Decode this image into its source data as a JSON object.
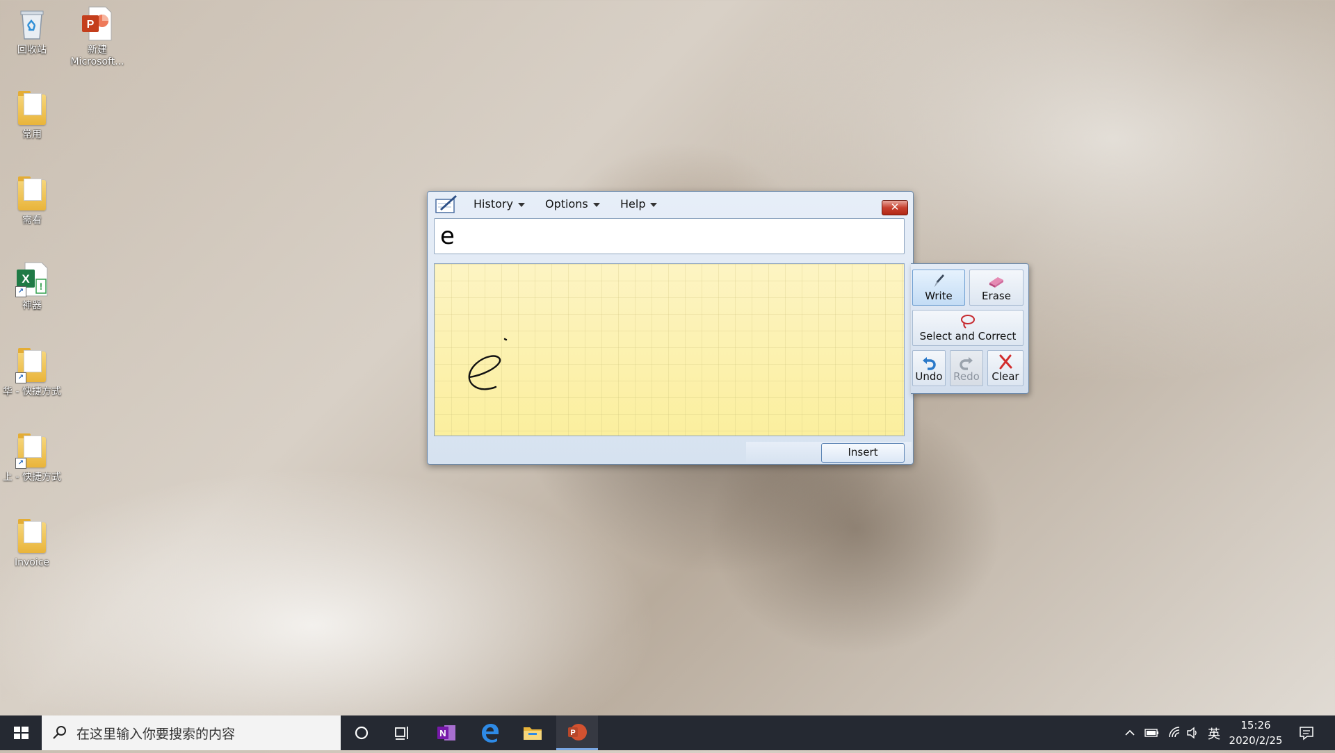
{
  "desktop": {
    "icons": [
      {
        "label": "回收站",
        "icon": "recycle-bin-icon"
      },
      {
        "label": "新建\nMicrosoft...",
        "label_line1": "新建",
        "label_line2": "Microsoft...",
        "icon": "powerpoint-file-icon"
      },
      {
        "label": "常用",
        "icon": "folder-icon"
      },
      {
        "label": "需看",
        "icon": "folder-icon"
      },
      {
        "label": "神器",
        "icon": "excel-file-icon"
      },
      {
        "label": "华 - 快捷方式",
        "icon": "folder-shortcut-icon"
      },
      {
        "label": "上 - 快捷方式",
        "icon": "folder-shortcut-icon"
      },
      {
        "label": "Invoice",
        "icon": "folder-icon"
      }
    ]
  },
  "handwriting_panel": {
    "menus": {
      "history": "History",
      "options": "Options",
      "help": "Help"
    },
    "close_label": "✕",
    "recognized_text": "e",
    "insert_label": "Insert",
    "tools": {
      "write": "Write",
      "erase": "Erase",
      "select_correct": "Select and Correct",
      "undo": "Undo",
      "redo": "Redo",
      "clear": "Clear"
    },
    "active_tool": "Write",
    "disabled_tools": [
      "Redo"
    ]
  },
  "taskbar": {
    "search_placeholder": "在这里输入你要搜索的内容",
    "pinned": [
      "cortana-icon",
      "task-view-icon",
      "onenote-icon",
      "edge-icon",
      "file-explorer-icon",
      "powerpoint-icon"
    ],
    "active_app": "powerpoint-icon",
    "ime_indicator": "英",
    "time": "15:26",
    "date": "2020/2/25"
  },
  "colors": {
    "taskbar": "#252932",
    "pad": "#fdf6c6",
    "accent": "#79a6e2"
  }
}
